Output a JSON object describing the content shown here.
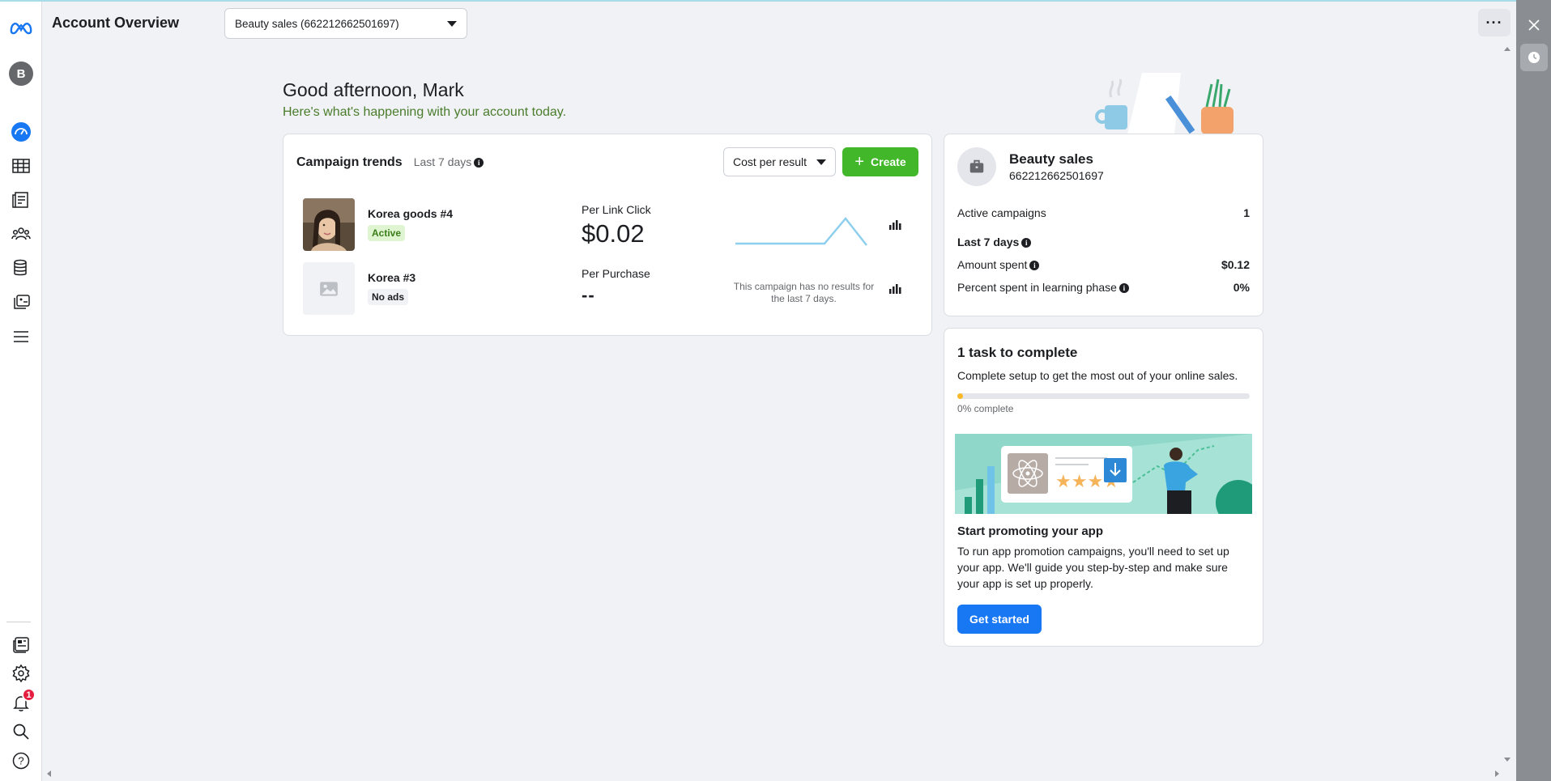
{
  "header": {
    "title": "Account Overview",
    "account_selector": "Beauty sales (662212662501697)",
    "more_label": "···"
  },
  "rail": {
    "avatar_letter": "B",
    "notification_count": "1"
  },
  "greeting": {
    "title": "Good afternoon, Mark",
    "subtitle": "Here's what's happening with your account today."
  },
  "trends": {
    "title": "Campaign trends",
    "range": "Last 7 days",
    "metric_select": "Cost per result",
    "create_label": "Create",
    "campaigns": [
      {
        "name": "Korea goods #4",
        "status": "Active",
        "metric_label": "Per Link Click",
        "metric_value": "$0.02"
      },
      {
        "name": "Korea #3",
        "status": "No ads",
        "metric_label": "Per Purchase",
        "metric_value": "--",
        "no_results": "This campaign has no results for the last 7 days."
      }
    ]
  },
  "account": {
    "name": "Beauty sales",
    "id": "662212662501697",
    "active_campaigns_label": "Active campaigns",
    "active_campaigns_value": "1",
    "period_label": "Last 7 days",
    "amount_spent_label": "Amount spent",
    "amount_spent_value": "$0.12",
    "learning_label": "Percent spent in learning phase",
    "learning_value": "0%"
  },
  "task": {
    "title": "1 task to complete",
    "description": "Complete setup to get the most out of your online sales.",
    "progress_fraction": 0.02,
    "progress_label": "0% complete",
    "promo_title": "Start promoting your app",
    "promo_text": "To run app promotion campaigns, you'll need to set up your app. We'll guide you step-by-step and make sure your app is set up properly.",
    "button_label": "Get started"
  },
  "colors": {
    "brand_blue": "#1877f2",
    "create_green": "#42b72a",
    "active_badge_bg": "#dff5d1",
    "progress_yellow": "#f7b928",
    "subtitle_green": "#4a7c2c"
  },
  "icons": {
    "rail": [
      "meta-logo-icon",
      "account-avatar",
      "dashboard-icon",
      "table-icon",
      "pages-icon",
      "audiences-icon",
      "database-icon",
      "media-library-icon",
      "menu-icon",
      "ads-reporting-icon",
      "settings-gear-icon",
      "bell-icon",
      "search-icon",
      "help-icon"
    ],
    "right_panel": [
      "close-icon",
      "clock-icon"
    ]
  }
}
